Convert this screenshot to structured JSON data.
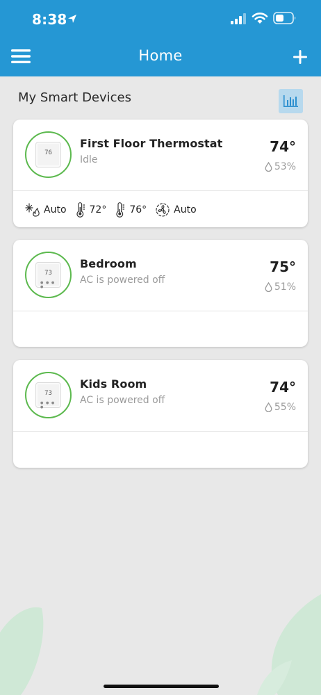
{
  "status_bar": {
    "time": "8:38"
  },
  "nav": {
    "title": "Home",
    "menu_icon": "hamburger-menu-icon",
    "add_icon": "plus-icon"
  },
  "section": {
    "title": "My Smart Devices",
    "chart_icon": "bar-chart-icon"
  },
  "devices": [
    {
      "name": "First Floor Thermostat",
      "status": "Idle",
      "temperature": "74°",
      "humidity": "53%",
      "display_reading": "76",
      "settings": {
        "mode": "Auto",
        "heat_setpoint": "72°",
        "cool_setpoint": "76°",
        "fan": "Auto"
      }
    },
    {
      "name": "Bedroom",
      "status": "AC is powered off",
      "temperature": "75°",
      "humidity": "51%",
      "display_reading": "73"
    },
    {
      "name": "Kids Room",
      "status": "AC is powered off",
      "temperature": "74°",
      "humidity": "55%",
      "display_reading": "73"
    }
  ],
  "colors": {
    "header": "#2597d4",
    "background": "#e8e8e8",
    "ring": "#5cb94e",
    "chart_button": "#b7d9ee",
    "leaf": "#cfe8d6"
  }
}
